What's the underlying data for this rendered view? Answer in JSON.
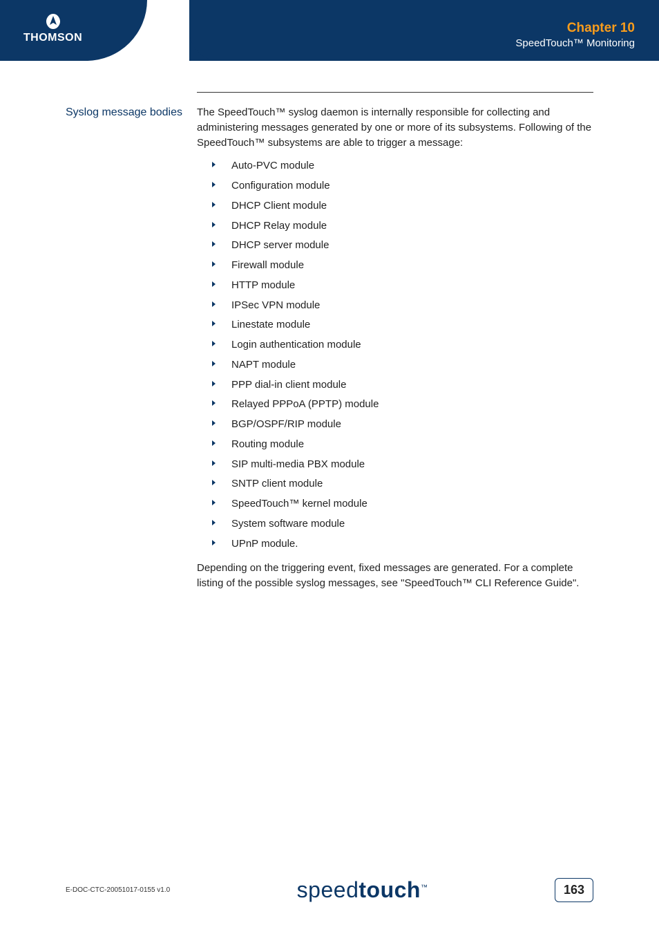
{
  "header": {
    "logo_text": "THOMSON",
    "chapter_label": "Chapter 10",
    "chapter_subtitle": "SpeedTouch™ Monitoring"
  },
  "section": {
    "label": "Syslog message bodies",
    "intro": "The SpeedTouch™ syslog daemon is internally responsible for collecting and administering messages generated by one or more of its subsystems. Following of the SpeedTouch™ subsystems are able to trigger a message:",
    "modules": [
      "Auto-PVC module",
      "Configuration module",
      "DHCP Client module",
      "DHCP Relay module",
      "DHCP server module",
      "Firewall module",
      "HTTP module",
      "IPSec VPN module",
      "Linestate module",
      "Login authentication module",
      "NAPT module",
      "PPP dial-in client module",
      "Relayed PPPoA (PPTP) module",
      "BGP/OSPF/RIP module",
      "Routing module",
      "SIP multi-media PBX module",
      "SNTP client module",
      "SpeedTouch™ kernel module",
      "System software module",
      "UPnP module."
    ],
    "outro": "Depending on the triggering event, fixed messages are generated. For a complete listing of the possible syslog messages, see \"SpeedTouch™ CLI Reference Guide\"."
  },
  "footer": {
    "doc_id": "E-DOC-CTC-20051017-0155 v1.0",
    "brand_light": "speed",
    "brand_bold": "touch",
    "brand_tm": "™",
    "page_number": "163"
  }
}
